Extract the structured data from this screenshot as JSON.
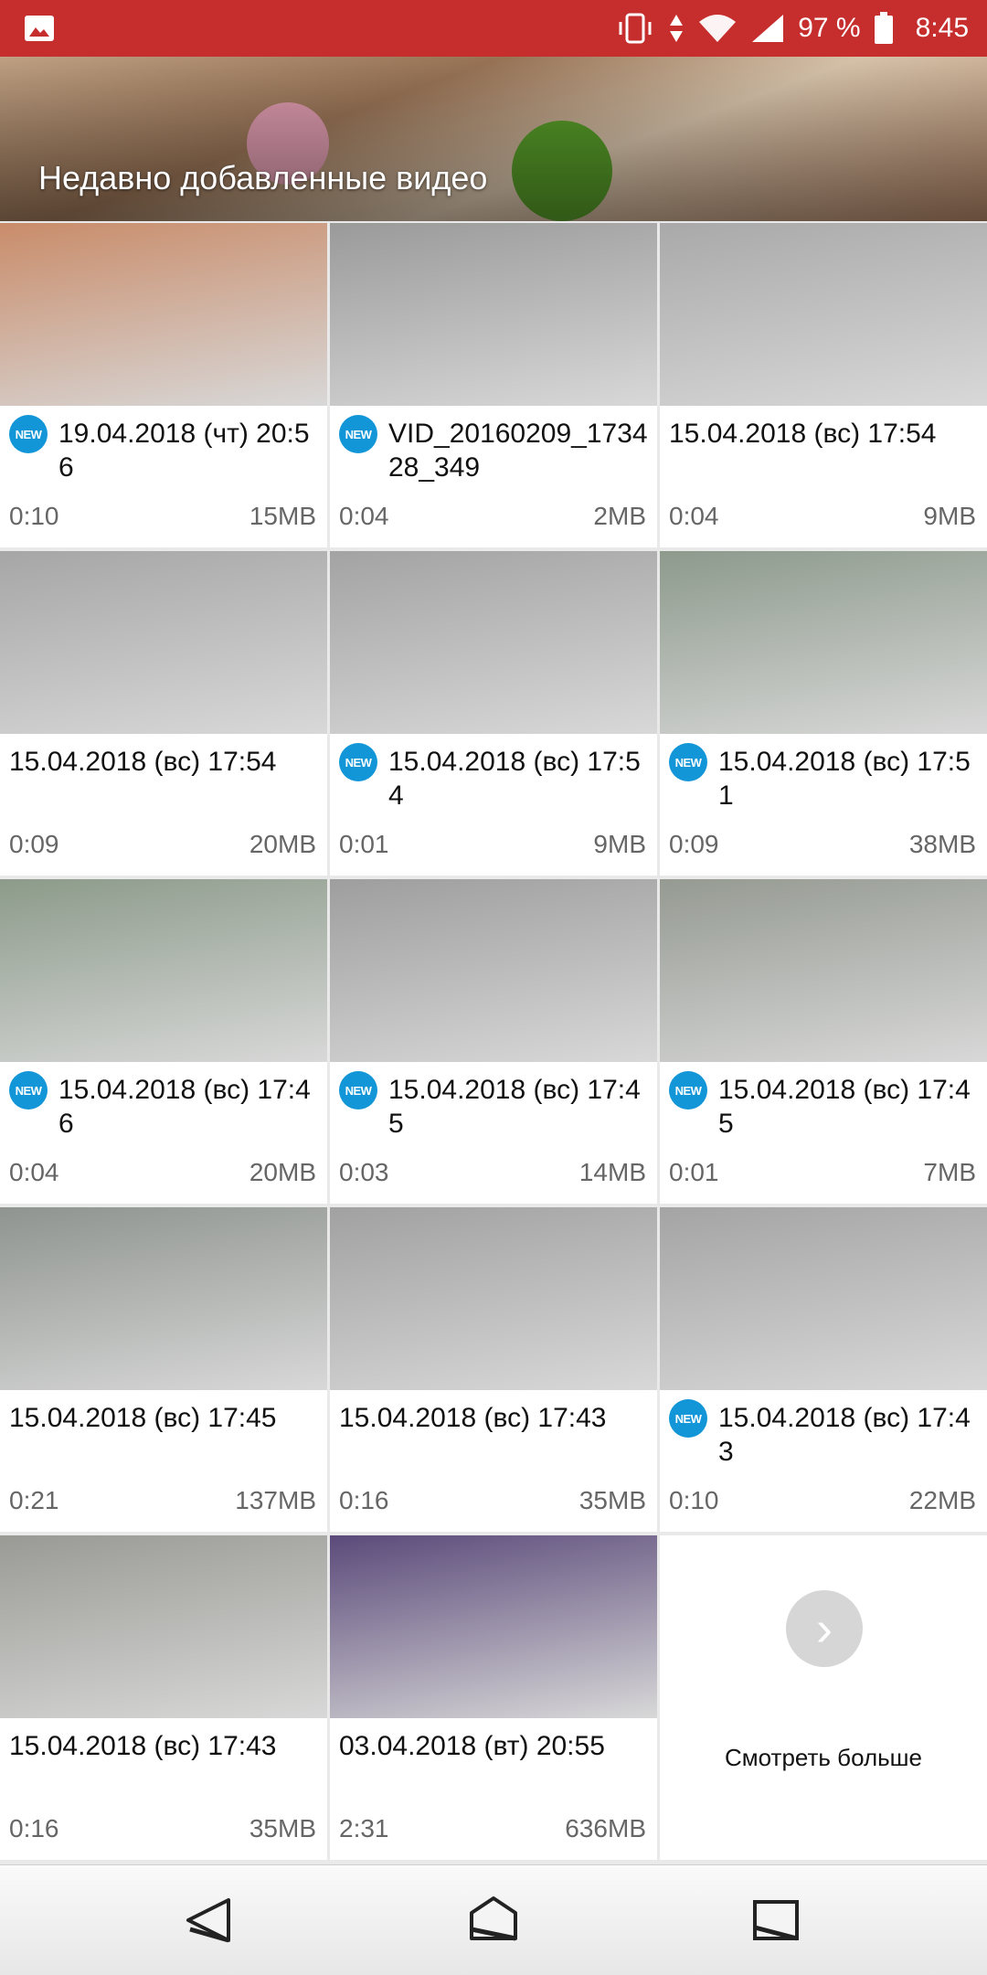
{
  "status_bar": {
    "battery_pct": "97 %",
    "time": "8:45",
    "icons": [
      "gallery-icon",
      "vibrate-icon",
      "data-arrows-icon",
      "wifi-icon",
      "signal-icon",
      "battery-icon"
    ]
  },
  "header": {
    "title": "Недавно добавленные видео"
  },
  "badge_text": "NEW",
  "videos": [
    {
      "name": "19.04.2018 (чт) 20:56",
      "duration": "0:10",
      "size": "15MB",
      "new": true,
      "thumb_bg": "#c98c6a"
    },
    {
      "name": "VID_20160209_173428_349",
      "duration": "0:04",
      "size": "2MB",
      "new": true,
      "thumb_bg": "#9a9a9a"
    },
    {
      "name": "15.04.2018 (вс) 17:54",
      "duration": "0:04",
      "size": "9MB",
      "new": false,
      "thumb_bg": "#a9a9a9"
    },
    {
      "name": "15.04.2018 (вс) 17:54",
      "duration": "0:09",
      "size": "20MB",
      "new": false,
      "thumb_bg": "#a6a6a6"
    },
    {
      "name": "15.04.2018 (вс) 17:54",
      "duration": "0:01",
      "size": "9MB",
      "new": true,
      "thumb_bg": "#a3a3a3"
    },
    {
      "name": "15.04.2018 (вс) 17:51",
      "duration": "0:09",
      "size": "38MB",
      "new": true,
      "thumb_bg": "#8d9a8c"
    },
    {
      "name": "15.04.2018 (вс) 17:46",
      "duration": "0:04",
      "size": "20MB",
      "new": true,
      "thumb_bg": "#8c9b8a"
    },
    {
      "name": "15.04.2018 (вс) 17:45",
      "duration": "0:03",
      "size": "14MB",
      "new": true,
      "thumb_bg": "#9e9e9e"
    },
    {
      "name": "15.04.2018 (вс) 17:45",
      "duration": "0:01",
      "size": "7MB",
      "new": true,
      "thumb_bg": "#959a92"
    },
    {
      "name": "15.04.2018 (вс) 17:45",
      "duration": "0:21",
      "size": "137MB",
      "new": false,
      "thumb_bg": "#8f9490"
    },
    {
      "name": "15.04.2018 (вс) 17:43",
      "duration": "0:16",
      "size": "35MB",
      "new": false,
      "thumb_bg": "#a1a1a1"
    },
    {
      "name": "15.04.2018 (вс) 17:43",
      "duration": "0:10",
      "size": "22MB",
      "new": true,
      "thumb_bg": "#a4a4a4"
    },
    {
      "name": "15.04.2018 (вс) 17:43",
      "duration": "0:16",
      "size": "35MB",
      "new": false,
      "thumb_bg": "#9a9a95"
    },
    {
      "name": "03.04.2018 (вт) 20:55",
      "duration": "2:31",
      "size": "636MB",
      "new": false,
      "thumb_bg": "#5b4a7a"
    }
  ],
  "more": {
    "label": "Смотреть больше",
    "icon": "chevron-right-icon"
  },
  "nav": {
    "back_icon": "back-icon",
    "home_icon": "home-icon",
    "recent_icon": "recent-apps-icon"
  },
  "colors": {
    "status_bar": "#c62d2d",
    "badge": "#1296d8"
  }
}
